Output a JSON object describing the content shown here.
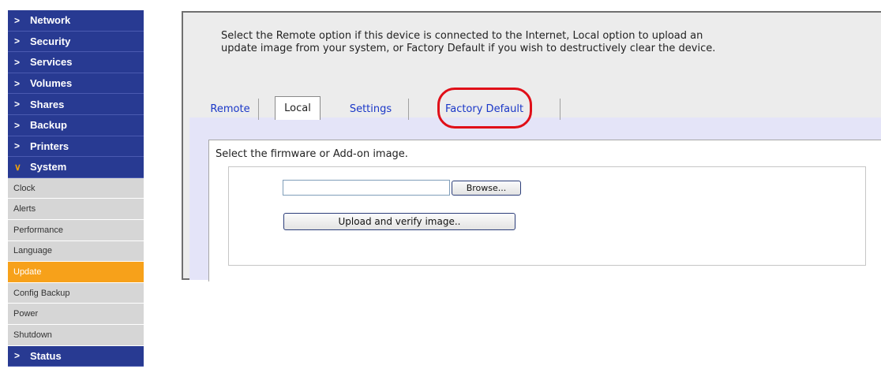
{
  "sidebar": {
    "top_items": [
      {
        "label": "Network"
      },
      {
        "label": "Security"
      },
      {
        "label": "Services"
      },
      {
        "label": "Volumes"
      },
      {
        "label": "Shares"
      },
      {
        "label": "Backup"
      },
      {
        "label": "Printers"
      }
    ],
    "system": {
      "label": "System",
      "expanded": true
    },
    "sub_items": [
      {
        "label": "Clock"
      },
      {
        "label": "Alerts"
      },
      {
        "label": "Performance"
      },
      {
        "label": "Language"
      },
      {
        "label": "Update",
        "active": true
      },
      {
        "label": "Config Backup"
      },
      {
        "label": "Power"
      },
      {
        "label": "Shutdown"
      }
    ],
    "status": {
      "label": "Status"
    },
    "icons": {
      "collapsed": "chevron-right-icon",
      "expanded": "chevron-down-icon"
    }
  },
  "content": {
    "intro_line1": "Select the Remote option if this device is connected to the Internet, Local option to upload an",
    "intro_line2": "update image from your system, or Factory Default if you wish to destructively clear the device.",
    "tabs": [
      {
        "label": "Remote"
      },
      {
        "label": "Local",
        "active": true
      },
      {
        "label": "Settings"
      },
      {
        "label": "Factory Default"
      }
    ],
    "panel": {
      "title": "Select the firmware or Add-on image.",
      "file_input_value": "",
      "browse_label": "Browse...",
      "upload_label": "Upload and verify image.."
    }
  },
  "colors": {
    "nav_blue": "#283a92",
    "nav_active_orange": "#f7a11a",
    "sub_gray": "#d6d6d6",
    "link_blue": "#1a37c8",
    "highlight_red": "#e00f18",
    "panel_lavender": "#e4e4f8"
  }
}
